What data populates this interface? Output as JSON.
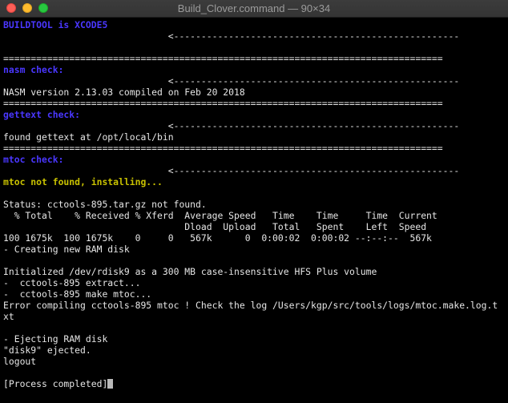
{
  "window": {
    "title": "Build_Clover.command — 90×34",
    "close_glyph": "",
    "minimize_glyph": "",
    "maximize_glyph": ""
  },
  "colors": {
    "background": "#000000",
    "text": "#e6e6e6",
    "heading_blue": "#4a37ff",
    "warning_yellow": "#c9c200"
  },
  "terminal": {
    "lines": [
      {
        "text": "BUILDTOOL is XCODE5",
        "style": "blue"
      },
      {
        "text": "                              <----------------------------------------------------",
        "style": "plain"
      },
      {
        "text": "",
        "style": "plain"
      },
      {
        "text": "================================================================================",
        "style": "plain"
      },
      {
        "text": "nasm check:",
        "style": "blue"
      },
      {
        "text": "                              <----------------------------------------------------",
        "style": "plain"
      },
      {
        "text": "NASM version 2.13.03 compiled on Feb 20 2018",
        "style": "plain"
      },
      {
        "text": "================================================================================",
        "style": "plain"
      },
      {
        "text": "gettext check:",
        "style": "blue"
      },
      {
        "text": "                              <----------------------------------------------------",
        "style": "plain"
      },
      {
        "text": "found gettext at /opt/local/bin",
        "style": "plain"
      },
      {
        "text": "================================================================================",
        "style": "plain"
      },
      {
        "text": "mtoc check:",
        "style": "blue"
      },
      {
        "text": "                              <----------------------------------------------------",
        "style": "plain"
      },
      {
        "text": "mtoc not found, installing...",
        "style": "yellow"
      },
      {
        "text": "",
        "style": "plain"
      },
      {
        "text": "Status: cctools-895.tar.gz not found.",
        "style": "plain"
      },
      {
        "text": "  % Total    % Received % Xferd  Average Speed   Time    Time     Time  Current",
        "style": "plain"
      },
      {
        "text": "                                 Dload  Upload   Total   Spent    Left  Speed",
        "style": "plain"
      },
      {
        "text": "100 1675k  100 1675k    0     0   567k      0  0:00:02  0:00:02 --:--:--  567k",
        "style": "plain"
      },
      {
        "text": "- Creating new RAM disk",
        "style": "plain"
      },
      {
        "text": "",
        "style": "plain"
      },
      {
        "text": "Initialized /dev/rdisk9 as a 300 MB case-insensitive HFS Plus volume",
        "style": "plain"
      },
      {
        "text": "-  cctools-895 extract...",
        "style": "plain"
      },
      {
        "text": "-  cctools-895 make mtoc...",
        "style": "plain"
      },
      {
        "text": "Error compiling cctools-895 mtoc ! Check the log /Users/kgp/src/tools/logs/mtoc.make.log.t",
        "style": "plain"
      },
      {
        "text": "xt",
        "style": "plain"
      },
      {
        "text": "",
        "style": "plain"
      },
      {
        "text": "- Ejecting RAM disk",
        "style": "plain"
      },
      {
        "text": "\"disk9\" ejected.",
        "style": "plain"
      },
      {
        "text": "logout",
        "style": "plain"
      },
      {
        "text": "",
        "style": "plain"
      },
      {
        "text": "[Process completed]",
        "style": "plain",
        "cursor": true
      }
    ]
  }
}
